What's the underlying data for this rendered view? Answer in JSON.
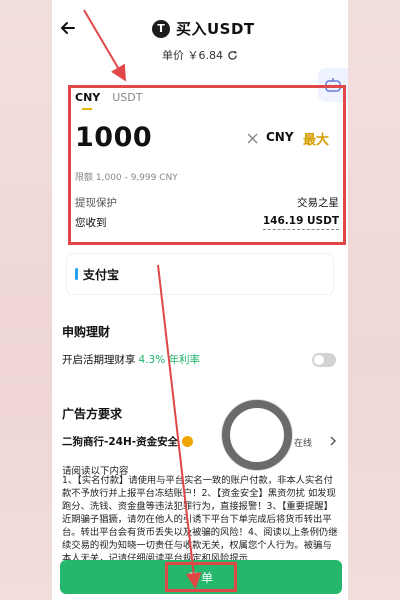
{
  "header": {
    "title": "买入USDT",
    "coin_letter": "T",
    "price": "单价 ￥6.84"
  },
  "order": {
    "tabs": [
      "CNY",
      "USDT"
    ],
    "amount": "1000",
    "unit": "CNY",
    "max_label": "最大",
    "limit": "限额 1,000 - 9,999 CNY",
    "protect_label": "提现保护",
    "protect_value": "交易之星",
    "receive_label": "您收到",
    "receive_value": "146.19 USDT"
  },
  "payment": {
    "method": "支付宝"
  },
  "subscribe": {
    "title": "申购理财",
    "toggle_text": "开启活期理财享",
    "toggle_rate": "4.3% 年利率"
  },
  "advertiser": {
    "title": "广告方要求",
    "merchant": "二狗商行-24H-资金安全",
    "status": "在线",
    "notice_title": "请阅读以下内容",
    "notice_body": "1、【实名付款】请使用与平台实名一致的账户付款，非本人实名付款不予放行并上报平台冻结账户！2、【资金安全】黑资勿扰 如发现跑分、洗钱、资金盘等违法犯罪行为，直接报警！3、【重要提醒】近期骗子猖獗，请勿在他人的引诱下平台下单完成后将货币转出平台。转出平台会有货币丢失以及被骗的风险！4、阅读以上条例仍继续交易的视为知晓一切责任与收款无关，权属您个人行为。被骗与本人无关，记请仔细阅读平台规定和风险提示"
  },
  "footer": {
    "order_button": "下单"
  },
  "colors": {
    "accent_green": "#25b86c",
    "annotation_red": "#e04848",
    "max_gold": "#d69e00"
  }
}
